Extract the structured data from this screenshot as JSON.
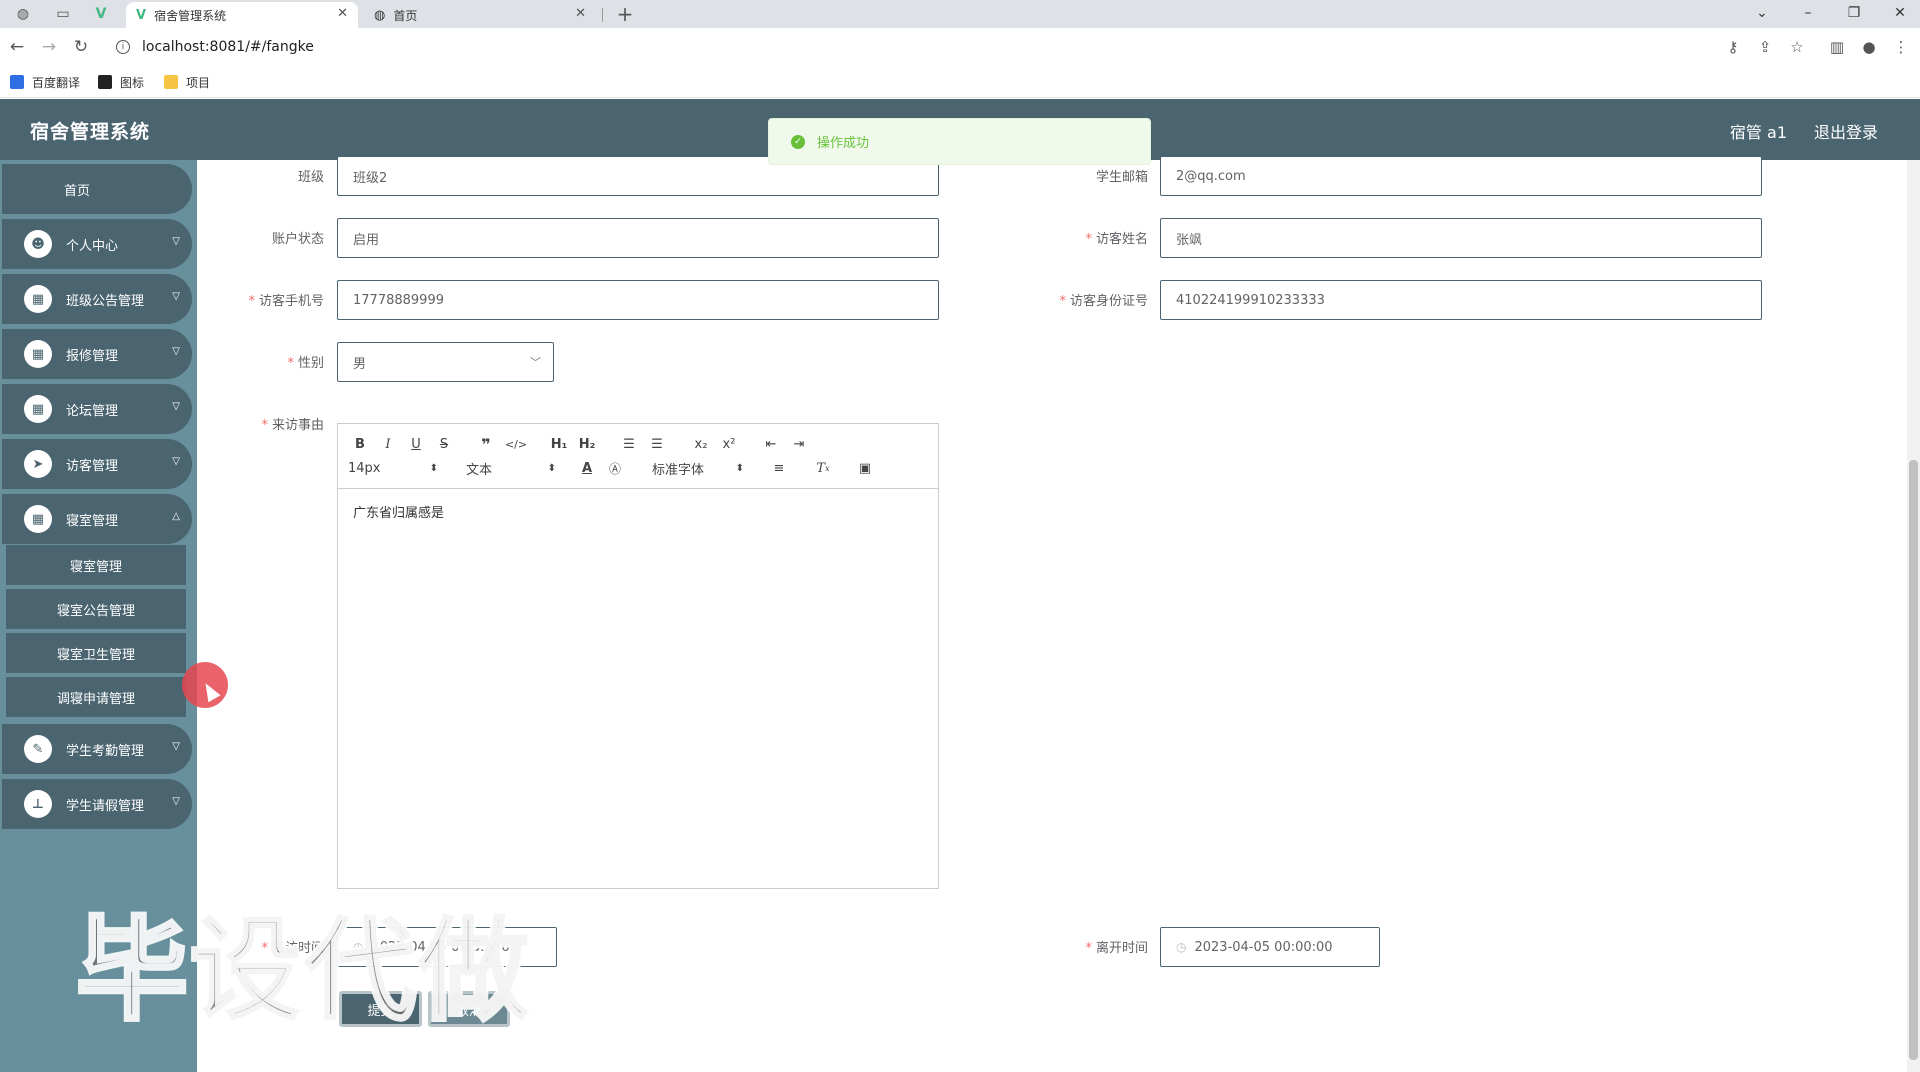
{
  "browser": {
    "tabs": [
      {
        "title": "宿舍管理系统",
        "active": true
      },
      {
        "title": "首页",
        "active": false
      }
    ],
    "new_tab_symbol": "+",
    "url": "localhost:8081/#/fangke",
    "bookmarks": [
      "百度翻译",
      "图标",
      "项目"
    ]
  },
  "header": {
    "title": "宿舍管理系统",
    "user": "宿管 a1",
    "logout": "退出登录"
  },
  "toast": {
    "message": "操作成功",
    "color": "#67c23a"
  },
  "sidebar": {
    "home": "首页",
    "items": [
      {
        "label": "个人中心",
        "icon": "user-icon"
      },
      {
        "label": "班级公告管理",
        "icon": "grid-icon"
      },
      {
        "label": "报修管理",
        "icon": "grid-icon"
      },
      {
        "label": "论坛管理",
        "icon": "grid-icon"
      },
      {
        "label": "访客管理",
        "icon": "send-icon"
      },
      {
        "label": "寝室管理",
        "icon": "grid-icon"
      }
    ],
    "submenu": [
      "寝室管理",
      "寝室公告管理",
      "寝室卫生管理",
      "调寝申请管理"
    ],
    "items_after": [
      {
        "label": "学生考勤管理",
        "icon": "clipboard-icon"
      },
      {
        "label": "学生请假管理",
        "icon": "stamp-icon"
      }
    ]
  },
  "form": {
    "class_label": "班级",
    "class_value": "班级2",
    "email_label": "学生邮箱",
    "email_value": "2@qq.com",
    "status_label": "账户状态",
    "status_value": "启用",
    "visitor_name_label": "访客姓名",
    "visitor_name_value": "张飒",
    "phone_label": "访客手机号",
    "phone_value": "17778889999",
    "id_label": "访客身份证号",
    "id_value": "410224199910233333",
    "gender_label": "性别",
    "gender_value": "男",
    "reason_label": "来访事由",
    "editor": {
      "font_size": "14px",
      "format": "文本",
      "font": "标准字体",
      "content": "广东省归属感是"
    },
    "arrive_label": "来访时间",
    "arrive_value": "2023-04-05 09:55:56",
    "leave_label": "离开时间",
    "leave_value": "2023-04-05 00:00:00",
    "submit": "提交",
    "cancel": "取消"
  },
  "watermark": "毕设代做",
  "colors": {
    "primary": "#4a6470",
    "sidebar_bg": "#68909c",
    "required": "#f56c6c"
  }
}
